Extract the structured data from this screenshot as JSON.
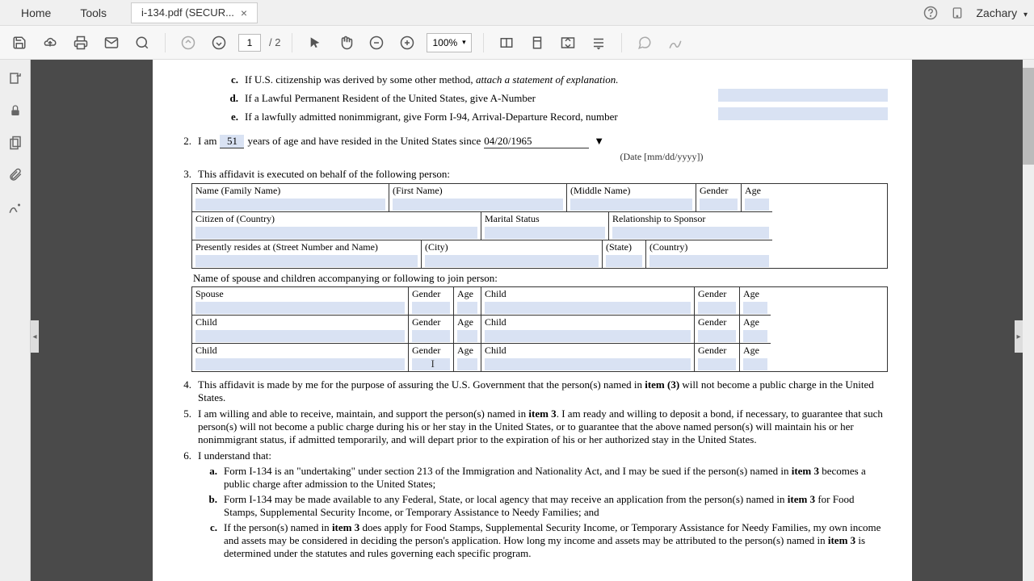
{
  "titlebar": {
    "home": "Home",
    "tools": "Tools",
    "docTitle": "i-134.pdf (SECUR...",
    "user": "Zachary"
  },
  "toolbar": {
    "page": "1",
    "pageTotal": "/ 2",
    "zoom": "100%"
  },
  "form": {
    "c": "If U.S. citizenship was derived by some other method,",
    "cItal": "attach a statement of explanation.",
    "d": "If a Lawful Permanent Resident of the United States, give A-Number",
    "e": "If a lawfully admitted nonimmigrant, give Form I-94, Arrival-Departure Record, number",
    "q2a": "I am",
    "q2age": "51",
    "q2b": "years of age and have resided in the United States since",
    "q2date": "04/20/1965",
    "q2hint": "(Date [mm/dd/yyyy])",
    "q3": "This affidavit is executed on behalf of the following person:",
    "h_name": "Name   (Family Name)",
    "h_first": "(First Name)",
    "h_middle": "(Middle Name)",
    "h_gender": "Gender",
    "h_age": "Age",
    "h_citizen": "Citizen of (Country)",
    "h_marital": "Marital Status",
    "h_rel": "Relationship to Sponsor",
    "h_resides": "Presently resides at (Street Number and Name)",
    "h_city": "(City)",
    "h_state": "(State)",
    "h_country": "(Country)",
    "q3b": "Name of spouse and children accompanying or following to join person:",
    "h_spouse": "Spouse",
    "h_child": "Child",
    "q4": "This affidavit is made by me for the purpose of assuring the U.S. Government that the person(s) named in ",
    "q4b": " will not become a public charge in the United States.",
    "item3": "item (3)",
    "q5a": "I am willing and able to receive, maintain, and support the person(s) named in ",
    "q5item": "item 3",
    "q5b": ".  I am ready and willing to deposit a bond, if necessary, to guarantee that such person(s) will not become a public charge during his or her stay in the United States, or to guarantee that the above named person(s) will maintain his or her nonimmigrant status, if admitted temporarily, and will depart prior to the expiration of his or her authorized stay in the United States.",
    "q6": "I understand that:",
    "q6a1": "Form I-134 is an \"undertaking\" under section 213 of the Immigration and Nationality Act, and I may be sued if the person(s) named in ",
    "q6a2": " becomes a public charge after admission to the United States;",
    "q6b1": "Form I-134 may be made available to any Federal, State, or local agency that may receive an application from the person(s) named in ",
    "q6b2": " for Food Stamps, Supplemental Security Income, or Temporary Assistance to Needy Families; and",
    "q6c1": "If the person(s) named in ",
    "q6c2": " does apply for Food Stamps, Supplemental Security Income, or Temporary Assistance for Needy Families, my own income and assets may be considered in deciding the person's application.  How long my income and assets may be attributed to the person(s) named in ",
    "q6c3": " is determined under the statutes and rules governing each specific program."
  }
}
